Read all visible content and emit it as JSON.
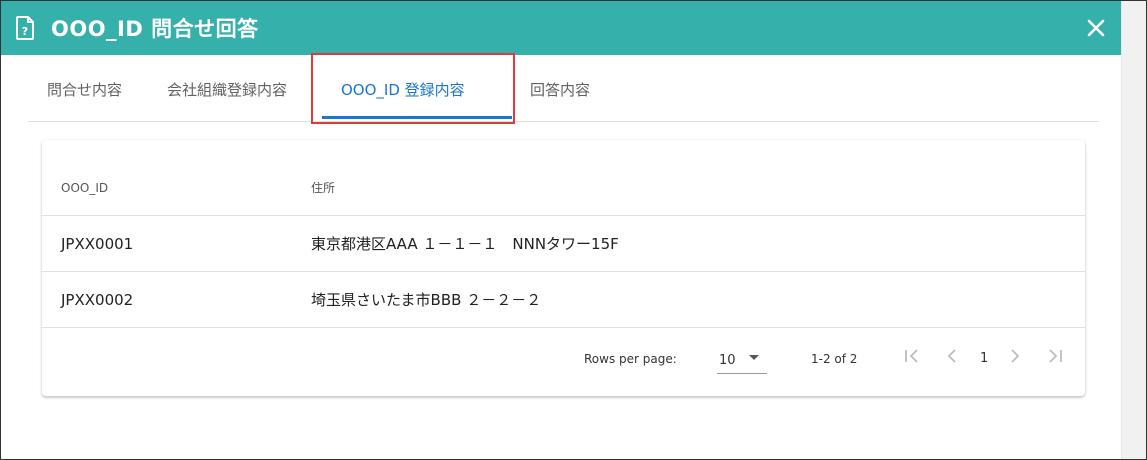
{
  "dialog": {
    "title": "OOO_ID 問合せ回答"
  },
  "tabs": [
    {
      "label": "問合せ内容"
    },
    {
      "label": "会社組織登録内容"
    },
    {
      "label": "OOO_ID 登録内容"
    },
    {
      "label": "回答内容"
    }
  ],
  "active_tab": 2,
  "table": {
    "headers": [
      "OOO_ID",
      "住所"
    ],
    "rows": [
      [
        "JPXX0001",
        "東京都港区AAA １－１－１　NNNタワー15F"
      ],
      [
        "JPXX0002",
        "埼玉県さいたま市BBB ２－２－２"
      ]
    ]
  },
  "pagination": {
    "rows_per_page_label": "Rows per page:",
    "rows_per_page_value": "10",
    "range_text": "1-2 of 2",
    "current_page": "1"
  },
  "colors": {
    "header_bg": "#36b0ab",
    "accent": "#1976d2",
    "highlight": "#e03a3a"
  },
  "icons": {
    "title": "help-document-icon",
    "close": "close-icon",
    "first_page": "first-page-icon",
    "prev_page": "chevron-left-icon",
    "next_page": "chevron-right-icon",
    "last_page": "last-page-icon",
    "dropdown": "caret-down-icon"
  }
}
